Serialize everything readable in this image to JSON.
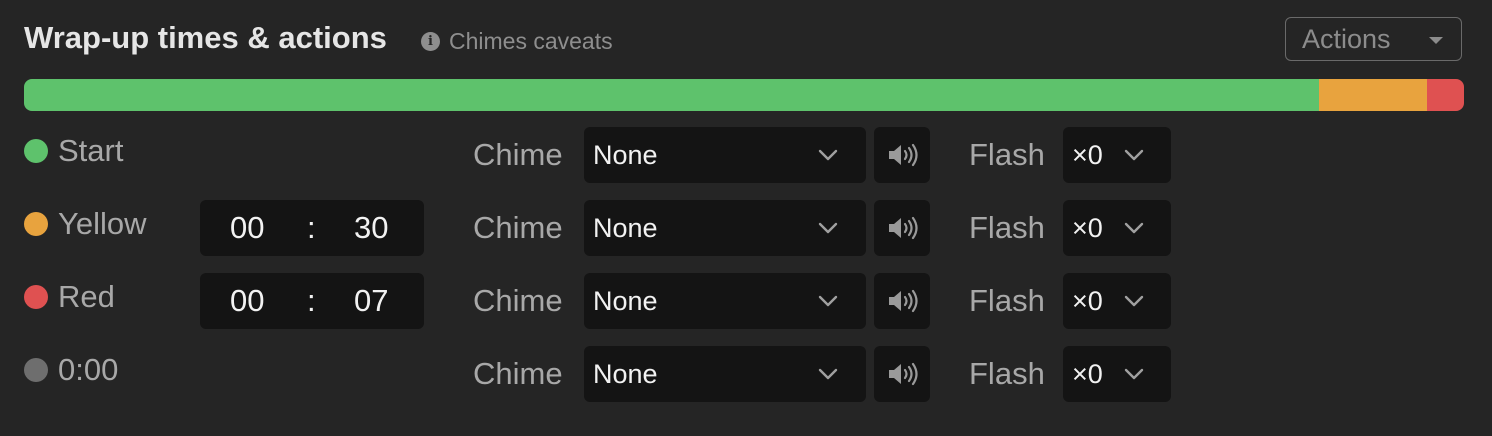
{
  "header": {
    "title": "Wrap-up times & actions",
    "caveats_label": "Chimes caveats",
    "caveats_icon": "info-icon",
    "actions_label": "Actions"
  },
  "progress_bar": {
    "segments": [
      {
        "name": "green",
        "color": "#5ec26c",
        "fraction": 0.8993
      },
      {
        "name": "yellow",
        "color": "#e8a33e",
        "fraction": 0.075
      },
      {
        "name": "red",
        "color": "#df5151",
        "fraction": 0.0257
      }
    ]
  },
  "rows": [
    {
      "key": "start",
      "label": "Start",
      "color": "#5ec26c",
      "time": null,
      "chime_label": "Chime",
      "chime_value": "None",
      "flash_label": "Flash",
      "flash_value": "×0"
    },
    {
      "key": "yellow",
      "label": "Yellow",
      "color": "#e8a33e",
      "time": {
        "minutes": "00",
        "separator": ":",
        "seconds": "30"
      },
      "chime_label": "Chime",
      "chime_value": "None",
      "flash_label": "Flash",
      "flash_value": "×0"
    },
    {
      "key": "red",
      "label": "Red",
      "color": "#df5151",
      "time": {
        "minutes": "00",
        "separator": ":",
        "seconds": "07"
      },
      "chime_label": "Chime",
      "chime_value": "None",
      "flash_label": "Flash",
      "flash_value": "×0"
    },
    {
      "key": "end",
      "label": "0:00",
      "color": "#6e6e6e",
      "time": null,
      "chime_label": "Chime",
      "chime_value": "None",
      "flash_label": "Flash",
      "flash_value": "×0"
    }
  ],
  "icons": {
    "chime_dropdown": "chevron-down-icon",
    "preview": "speaker-icon",
    "flash_dropdown": "chevron-down-icon"
  }
}
